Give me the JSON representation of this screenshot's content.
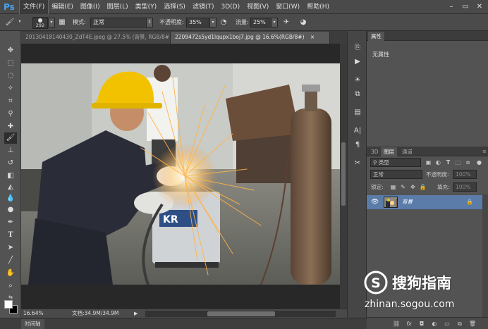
{
  "app": {
    "logo": "Ps"
  },
  "menu": [
    "文件(F)",
    "编辑(E)",
    "图像(I)",
    "图层(L)",
    "类型(Y)",
    "选择(S)",
    "滤镜(T)",
    "3D(D)",
    "视图(V)",
    "窗口(W)",
    "帮助(H)"
  ],
  "window_controls": {
    "minimize": "–",
    "maximize": "▭",
    "close": "✕"
  },
  "options": {
    "brush_size": "292",
    "mode_label": "模式:",
    "mode_value": "正常",
    "opacity_label": "不透明度:",
    "opacity_value": "35%",
    "flow_label": "流量:",
    "flow_value": "25%"
  },
  "tabs": [
    {
      "label": "20130418140430_ZdT4E.jpeg @ 27.5% (背景, RGB/8#) *",
      "active": false,
      "close": "×"
    },
    {
      "label": "2209472s5yd1lqupx1boj7.jpg @ 16.6%(RGB/8#)",
      "active": true,
      "close": "×"
    }
  ],
  "status": {
    "zoom": "16.64%",
    "doc_info": "文档:34.9M/34.9M",
    "timeline_tab": "时间轴"
  },
  "panels": {
    "properties": {
      "tab": "属性",
      "no_properties": "无属性"
    },
    "layers": {
      "tabs": [
        "3D",
        "图层",
        "通道"
      ],
      "filter_kind": "类型",
      "blend_mode": "正常",
      "opacity_label": "不透明度:",
      "opacity_value": "100%",
      "lock_label": "锁定:",
      "fill_label": "填充:",
      "fill_value": "100%",
      "items": [
        {
          "name": "背景",
          "visible": true,
          "locked": true
        }
      ]
    }
  },
  "watermark": {
    "brand": "搜狗指南",
    "url": "zhinan.sogou.com"
  },
  "colors": {
    "accent": "#4aa3f0",
    "layer_selected": "#5b7ba9",
    "helmet": "#f2c200",
    "sparks": "#ffb347"
  }
}
